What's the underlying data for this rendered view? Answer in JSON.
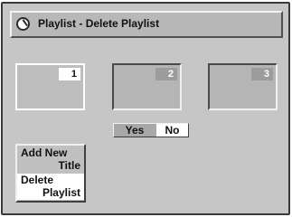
{
  "title": {
    "text": "Playlist - Delete Playlist",
    "icon": "disc-icon"
  },
  "thumbnails": [
    {
      "number": "1",
      "selected": true
    },
    {
      "number": "2",
      "selected": false
    },
    {
      "number": "3",
      "selected": false
    }
  ],
  "confirm": {
    "yes_label": "Yes",
    "no_label": "No",
    "selected": "No"
  },
  "menu": {
    "items": [
      {
        "line1": "Add New",
        "line2": "Title",
        "selected": false
      },
      {
        "line1": "Delete",
        "line2": "Playlist",
        "selected": true
      }
    ]
  },
  "colors": {
    "screen_bg": "#c6c6c6",
    "highlight": "#ffffff",
    "title_bg": "#b8b8b8"
  }
}
